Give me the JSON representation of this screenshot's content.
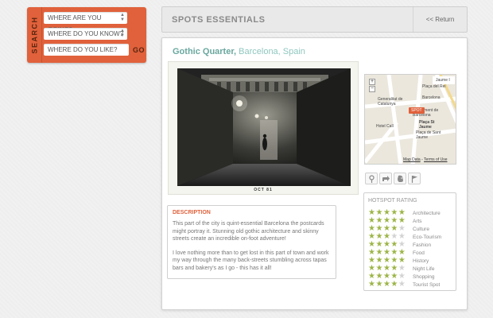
{
  "search": {
    "tab_label": "SEARCH",
    "where_going": "WHERE ARE YOU GOING?",
    "where_know": "WHERE DO YOU KNOW?",
    "where_like": "WHERE DO YOU LIKE?",
    "go_label": "GO"
  },
  "header": {
    "title": "SPOTS ESSENTIALS",
    "return_label": "<< Return"
  },
  "spot": {
    "name": "Gothic Quarter,",
    "location": "Barcelona, Spain",
    "photo_caption": "OCT   81"
  },
  "description": {
    "heading": "DESCRIPTION",
    "paragraph1": "This part of the city is quint-essential Barcelona the postcards might portray it. Stunning old gothic architecture and skinny streets create an incredible on-foot adventure!",
    "paragraph2": "I love nothing more than to get lost in this part of town and work my way through the many back-streets stumbling across tapas bars and bakery's as I go - this has it all!"
  },
  "map": {
    "labels": [
      "Jaume I",
      "Plaça del Rei",
      "Generalitat de Catalunya",
      "Ajuntament de Barcelona",
      "Hotel Call",
      "Plaça St Jaume",
      "Plaça de Sant Jaume",
      "Barcelona"
    ],
    "marker_label": "SPOT",
    "footer_data": "Map Data",
    "footer_terms": "Terms of Use"
  },
  "actions": [
    "pin-icon",
    "share-icon",
    "evernote-icon",
    "flag-icon"
  ],
  "rating": {
    "heading": "HOTSPOT RATING",
    "items": [
      {
        "label": "Architecture",
        "stars": 5
      },
      {
        "label": "Arts",
        "stars": 5
      },
      {
        "label": "Culture",
        "stars": 4
      },
      {
        "label": "Eco-Tourism",
        "stars": 3
      },
      {
        "label": "Fashion",
        "stars": 4
      },
      {
        "label": "Food",
        "stars": 5
      },
      {
        "label": "History",
        "stars": 5
      },
      {
        "label": "Night Life",
        "stars": 4
      },
      {
        "label": "Shopping",
        "stars": 4
      },
      {
        "label": "Tourist Spot",
        "stars": 4
      }
    ],
    "max_stars": 5,
    "star_color": "#9db548"
  },
  "colors": {
    "accent": "#e0613b",
    "title": "#6aa89f"
  }
}
